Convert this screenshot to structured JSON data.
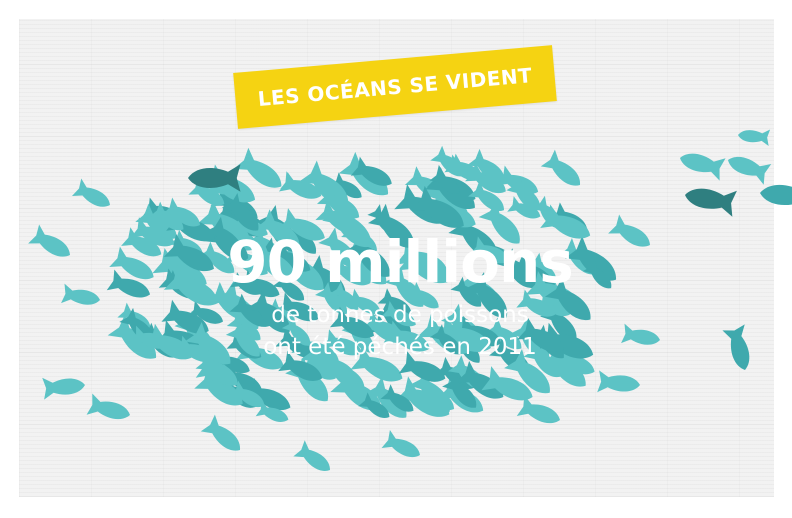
{
  "banner": {
    "text": "LES OCÉANS SE VIDENT",
    "color": "#f5d312"
  },
  "headline": {
    "value": "90 millions",
    "line1": "de tonnes de poissons",
    "line2": "ont été péchés en 2011"
  },
  "colors": {
    "fish_light": "#5cc3c5",
    "fish_mid": "#3fa9ad",
    "fish_dark": "#2f7f80",
    "background": "#f2f2f2"
  }
}
